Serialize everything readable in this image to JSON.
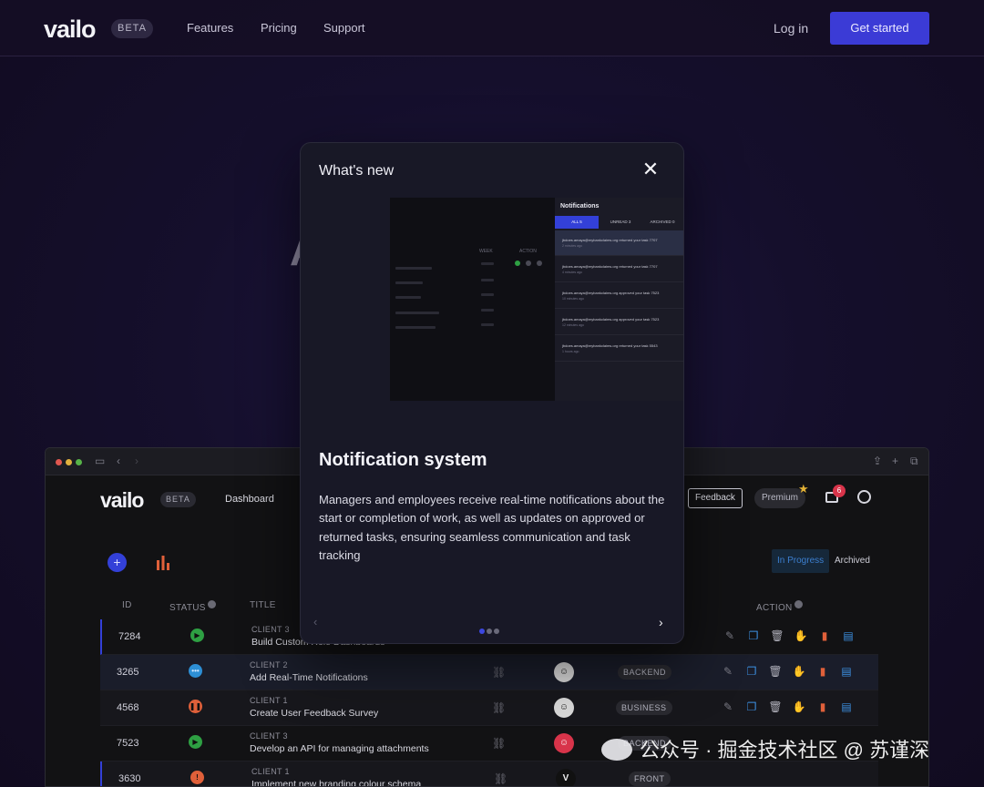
{
  "site": {
    "logo": "vailo",
    "beta": "BETA",
    "nav": [
      "Features",
      "Pricing",
      "Support"
    ],
    "login": "Log in",
    "cta": "Get started",
    "hero_partial": "A"
  },
  "app": {
    "logo": "vailo",
    "beta": "BETA",
    "nav_dashboard": "Dashboard",
    "feedback": "Feedback",
    "premium": "Premium",
    "inbox_count": "6",
    "tabs": [
      "In Progress",
      "Archived"
    ],
    "columns": {
      "id": "ID",
      "status": "STATUS",
      "title": "TITLE",
      "action": "ACTION"
    },
    "rows": [
      {
        "id": "7284",
        "client": "CLIENT 3",
        "title": "Build Custom Role Dashboards",
        "status_color": "#2ea043",
        "status_symbol": "▶",
        "tag": "",
        "avatar": ""
      },
      {
        "id": "3265",
        "client": "CLIENT 2",
        "title": "Add Real-Time Notifications",
        "status_color": "#2d8fd5",
        "status_symbol": "•••",
        "tag": "BACKEND",
        "avatar": "☺"
      },
      {
        "id": "4568",
        "client": "CLIENT 1",
        "title": "Create User Feedback Survey",
        "status_color": "#e0603a",
        "status_symbol": "❚❚",
        "tag": "BUSINESS",
        "avatar": "☺"
      },
      {
        "id": "7523",
        "client": "CLIENT 3",
        "title": "Develop an API for managing attachments",
        "status_color": "#2ea043",
        "status_symbol": "▶",
        "tag": "BACKEND",
        "avatar": "☺"
      },
      {
        "id": "3630",
        "client": "CLIENT 1",
        "title": "Implement new branding colour schema",
        "status_color": "#e0603a",
        "status_symbol": "!",
        "tag": "FRONT",
        "avatar": "V"
      }
    ]
  },
  "modal": {
    "title": "What's new",
    "feature_title": "Notification system",
    "feature_body": "Managers and employees receive real-time notifications about the start or completion of work, as well as updates on approved or returned tasks, ensuring seamless communication and task tracking",
    "preview": {
      "heading": "Notifications",
      "tabs": [
        "ALL 5",
        "UNREAD 3",
        "ARCHIVED 0"
      ],
      "items": [
        {
          "text": "jbdoes.amaya@mybankclaims.org returned your task 7707",
          "time": "2 minutes ago"
        },
        {
          "text": "jbdoes.amaya@mybankclaims.org returned your task 7707",
          "time": "4 minutes ago"
        },
        {
          "text": "jbdoes.amaya@mybankclaims.org approved your task 7523",
          "time": "10 minutes ago"
        },
        {
          "text": "jbdoes.amaya@mybankclaims.org approved your task 7523",
          "time": "12 minutes ago"
        },
        {
          "text": "jbdoes.amaya@mybankclaims.org returned your task 5543",
          "time": "1 hours ago"
        }
      ],
      "table_headers": [
        "WEEK",
        "ACTION"
      ]
    },
    "page": {
      "current": 1,
      "total": 3
    }
  },
  "watermark": "公众号 · 掘金技术社区 @ 苏谨深",
  "colors": {
    "accent": "#3b3bd6",
    "background": "#150f2c"
  }
}
